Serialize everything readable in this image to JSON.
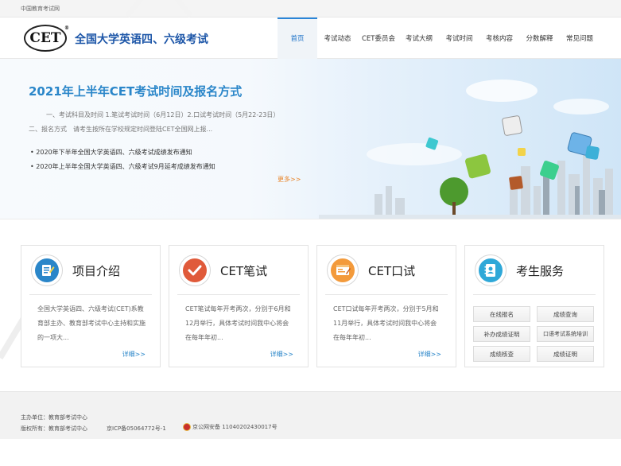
{
  "topbar": {
    "label": "中国教育考试网"
  },
  "header": {
    "logo_text": "CET",
    "logo_mark": "®",
    "site_title": "全国大学英语四、六级考试"
  },
  "nav": [
    {
      "label": "首页",
      "active": true
    },
    {
      "label": "考试动态"
    },
    {
      "label": "CET委员会"
    },
    {
      "label": "考试大纲"
    },
    {
      "label": "考试时间"
    },
    {
      "label": "考核内容"
    },
    {
      "label": "分数解释"
    },
    {
      "label": "常见问题"
    }
  ],
  "hero": {
    "title": "2021年上半年CET考试时间及报名方式",
    "desc": "一、考试科目及时间 1.笔试考试时间（6月12日）2.口试考试时间（5月22-23日） 二、报名方式　请考生按所在学校规定时间登陆CET全国网上报...",
    "news": [
      "2020年下半年全国大学英语四、六级考试成绩发布通知",
      "2020年上半年全国大学英语四、六级考试9月延考成绩发布通知"
    ],
    "more": "更多>>"
  },
  "cards": [
    {
      "title": "项目介绍",
      "text": "全国大学英语四、六级考试(CET)系教育部主办、教育部考试中心主持和实施的一项大...",
      "more": "详细>>"
    },
    {
      "title": "CET笔试",
      "text": "CET笔试每年开考两次，分别于6月和12月举行，具体考试时间我中心将会在每年年初...",
      "more": "详细>>"
    },
    {
      "title": "CET口试",
      "text": "CET口试每年开考两次，分别于5月和11月举行，具体考试时间我中心将会在每年年初...",
      "more": "详细>>"
    },
    {
      "title": "考生服务",
      "buttons": [
        "在线报名",
        "成绩查询",
        "补办成绩证明",
        "口语考试系统培训",
        "成绩核查",
        "成绩证明"
      ]
    }
  ],
  "footer": {
    "sponsor": "主办单位：教育部考试中心",
    "copyright": "版权所有：教育部考试中心",
    "icp": "京ICP备05064772号-1",
    "police": "京公网安备 11040202430017号"
  },
  "colors": {
    "accent": "#2a86c9",
    "brand": "#1d56a8",
    "more": "#e8852a",
    "icon_red": "#e05a3a",
    "icon_orange": "#f39a3b",
    "icon_blue": "#2a86c9"
  },
  "icons": [
    "document-icon",
    "checkmark-icon",
    "browser-window-icon",
    "address-book-icon",
    "police-badge-icon"
  ]
}
